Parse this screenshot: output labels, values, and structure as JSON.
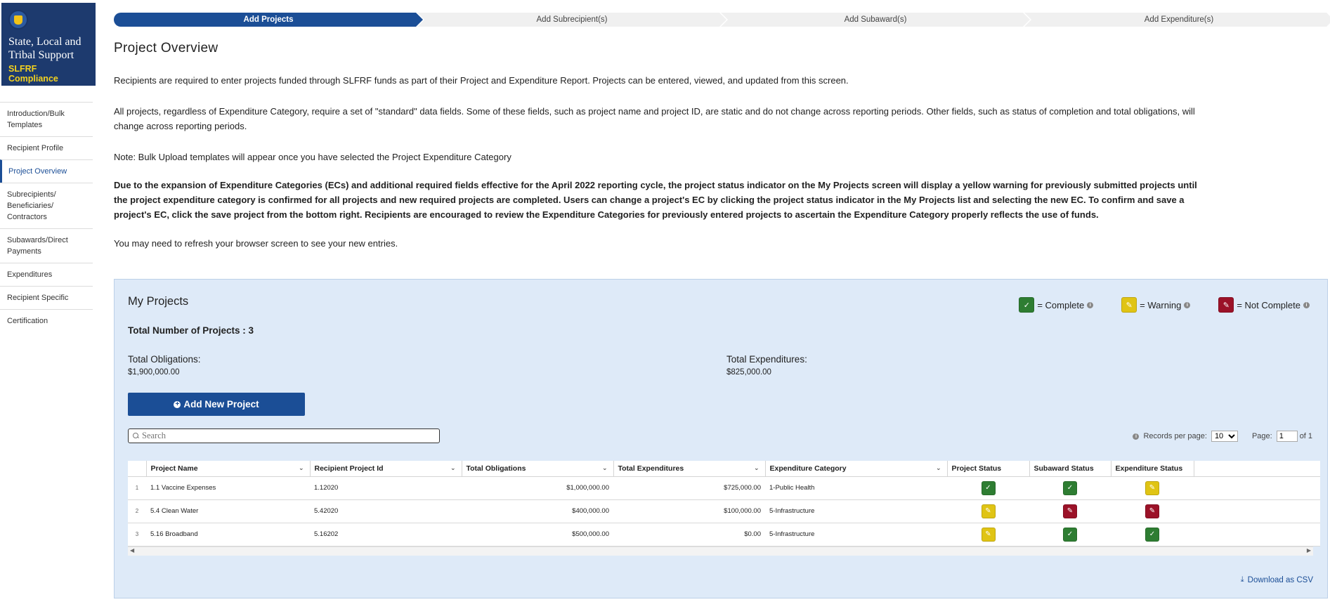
{
  "brand": {
    "title": "State, Local and Tribal Support",
    "subtitle": "SLFRF Compliance"
  },
  "sidebar": {
    "items": [
      {
        "label": "Introduction/Bulk Templates",
        "active": false
      },
      {
        "label": "Recipient Profile",
        "active": false
      },
      {
        "label": "Project Overview",
        "active": true
      },
      {
        "label": "Subrecipients/ Beneficiaries/ Contractors",
        "active": false
      },
      {
        "label": "Subawards/Direct Payments",
        "active": false
      },
      {
        "label": "Expenditures",
        "active": false
      },
      {
        "label": "Recipient Specific",
        "active": false
      },
      {
        "label": "Certification",
        "active": false
      }
    ]
  },
  "stepper": {
    "steps": [
      {
        "label": "Add Projects",
        "active": true
      },
      {
        "label": "Add Subrecipient(s)",
        "active": false
      },
      {
        "label": "Add Subaward(s)",
        "active": false
      },
      {
        "label": "Add Expenditure(s)",
        "active": false
      }
    ]
  },
  "page": {
    "title": "Project Overview",
    "paragraph1": "Recipients are required to enter projects funded through SLFRF funds as part of their Project and Expenditure Report. Projects can be entered, viewed, and updated from this screen.",
    "paragraph2": "All projects, regardless of Expenditure Category, require a set of \"standard\" data fields. Some of these fields, such as project name and project ID, are static and do not change across reporting periods. Other fields, such as status of completion and total obligations, will change across reporting periods.",
    "paragraph3": "Note: Bulk Upload templates will appear once you have selected the Project Expenditure Category",
    "paragraph4": "Due to the expansion of Expenditure Categories (ECs) and additional required fields effective for the April 2022 reporting cycle, the project status indicator on the My Projects screen will display a yellow warning for previously submitted projects until the project expenditure category is confirmed for all projects and new required projects are completed. Users can change a project's EC by clicking the project status indicator in the My Projects list and selecting the new EC. To confirm and save a project's EC, click the save project from the bottom right. Recipients are encouraged to review the Expenditure Categories for previously entered projects to ascertain the Expenditure Category properly reflects the use of funds.",
    "paragraph5": "You may need to refresh your browser screen to see your new entries."
  },
  "projects": {
    "title": "My Projects",
    "legend": {
      "complete": "= Complete",
      "warning": "= Warning",
      "not_complete": "= Not Complete"
    },
    "total_projects": "Total Number of Projects : 3",
    "obligations_label": "Total Obligations:",
    "obligations_value": "$1,900,000.00",
    "expenditures_label": "Total Expenditures:",
    "expenditures_value": "$825,000.00",
    "add_button": "Add New Project",
    "search_placeholder": "Search",
    "records_label": "Records per page:",
    "records_value": "10",
    "page_label": "Page:",
    "page_value": "1",
    "page_of": "of",
    "page_total": "1",
    "download": "Download as CSV",
    "columns": [
      "Project Name",
      "Recipient Project Id",
      "Total Obligations",
      "Total Expenditures",
      "Expenditure Category",
      "Project Status",
      "Subaward Status",
      "Expenditure Status"
    ],
    "rows": [
      {
        "num": "1",
        "name": "1.1 Vaccine Expenses",
        "id": "1.12020",
        "obligations": "$1,000,000.00",
        "expenditures": "$725,000.00",
        "category": "1-Public Health",
        "project_status": "complete",
        "subaward_status": "complete",
        "expenditure_status": "warning"
      },
      {
        "num": "2",
        "name": "5.4 Clean Water",
        "id": "5.42020",
        "obligations": "$400,000.00",
        "expenditures": "$100,000.00",
        "category": "5-Infrastructure",
        "project_status": "warning",
        "subaward_status": "not_complete",
        "expenditure_status": "not_complete"
      },
      {
        "num": "3",
        "name": "5.16 Broadband",
        "id": "5.16202",
        "obligations": "$500,000.00",
        "expenditures": "$0.00",
        "category": "5-Infrastructure",
        "project_status": "warning",
        "subaward_status": "complete",
        "expenditure_status": "complete"
      }
    ]
  },
  "colors": {
    "primary": "#1b4e96",
    "complete": "#2e7d32",
    "warning": "#e0c414",
    "not_complete": "#9b1228",
    "panel_bg": "#deeaf8"
  }
}
